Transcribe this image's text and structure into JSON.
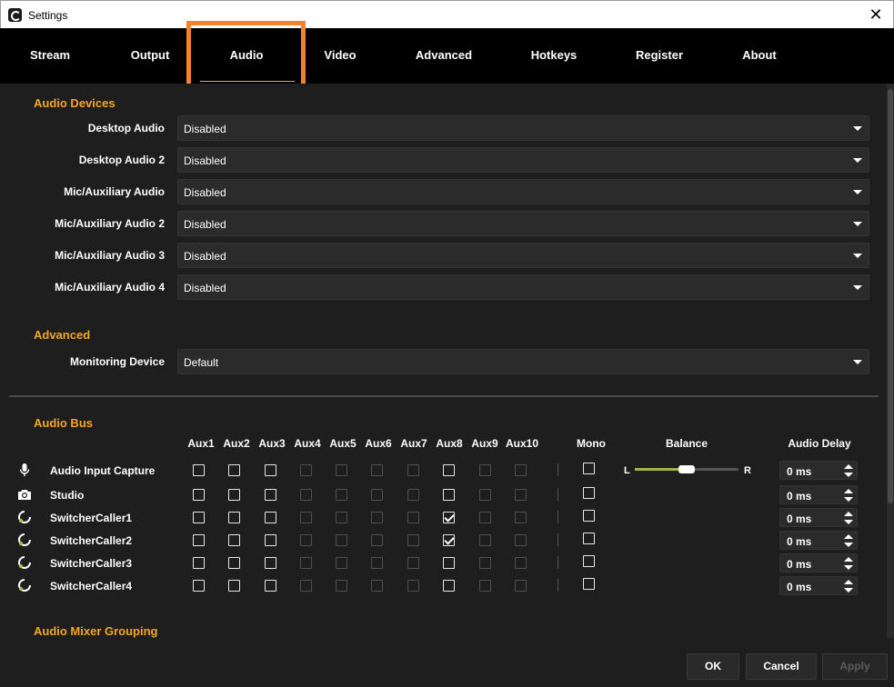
{
  "window": {
    "title": "Settings"
  },
  "tabs": [
    {
      "label": "Stream",
      "active": false
    },
    {
      "label": "Output",
      "active": false
    },
    {
      "label": "Audio",
      "active": true
    },
    {
      "label": "Video",
      "active": false
    },
    {
      "label": "Advanced",
      "active": false
    },
    {
      "label": "Hotkeys",
      "active": false
    },
    {
      "label": "Register",
      "active": false
    },
    {
      "label": "About",
      "active": false
    }
  ],
  "audio_devices": {
    "title": "Audio Devices",
    "rows": [
      {
        "label": "Desktop Audio",
        "value": "Disabled"
      },
      {
        "label": "Desktop Audio 2",
        "value": "Disabled"
      },
      {
        "label": "Mic/Auxiliary Audio",
        "value": "Disabled"
      },
      {
        "label": "Mic/Auxiliary Audio 2",
        "value": "Disabled"
      },
      {
        "label": "Mic/Auxiliary Audio 3",
        "value": "Disabled"
      },
      {
        "label": "Mic/Auxiliary Audio 4",
        "value": "Disabled"
      }
    ]
  },
  "advanced": {
    "title": "Advanced",
    "monitoring_label": "Monitoring Device",
    "monitoring_value": "Default"
  },
  "audio_bus": {
    "title": "Audio Bus",
    "aux_columns": [
      "Aux1",
      "Aux2",
      "Aux3",
      "Aux4",
      "Aux5",
      "Aux6",
      "Aux7",
      "Aux8",
      "Aux9",
      "Aux10"
    ],
    "aux_enabled": [
      true,
      true,
      true,
      false,
      false,
      false,
      false,
      true,
      false,
      false
    ],
    "mono_label": "Mono",
    "balance_label": "Balance",
    "balance_left": "L",
    "balance_right": "R",
    "balance_value": 0.5,
    "delay_label": "Audio Delay",
    "sources": [
      {
        "name": "Audio Input Capture",
        "icon": "microphone-icon",
        "checked": [
          false,
          false,
          false,
          false,
          false,
          false,
          false,
          false,
          false,
          false
        ],
        "mono": false,
        "has_balance": true,
        "delay": "0 ms"
      },
      {
        "name": "Studio",
        "icon": "camera-icon",
        "checked": [
          false,
          false,
          false,
          false,
          false,
          false,
          false,
          false,
          false,
          false
        ],
        "mono": false,
        "has_balance": false,
        "delay": "0 ms"
      },
      {
        "name": "SwitcherCaller1",
        "icon": "switcher-caller-icon",
        "checked": [
          false,
          false,
          false,
          false,
          false,
          false,
          false,
          true,
          false,
          false
        ],
        "mono": false,
        "has_balance": false,
        "delay": "0 ms"
      },
      {
        "name": "SwitcherCaller2",
        "icon": "switcher-caller-icon",
        "checked": [
          false,
          false,
          false,
          false,
          false,
          false,
          false,
          true,
          false,
          false
        ],
        "mono": false,
        "has_balance": false,
        "delay": "0 ms"
      },
      {
        "name": "SwitcherCaller3",
        "icon": "switcher-caller-icon",
        "checked": [
          false,
          false,
          false,
          false,
          false,
          false,
          false,
          false,
          false,
          false
        ],
        "mono": false,
        "has_balance": false,
        "delay": "0 ms"
      },
      {
        "name": "SwitcherCaller4",
        "icon": "switcher-caller-icon",
        "checked": [
          false,
          false,
          false,
          false,
          false,
          false,
          false,
          false,
          false,
          false
        ],
        "mono": false,
        "has_balance": false,
        "delay": "0 ms"
      }
    ]
  },
  "grouping": {
    "title": "Audio Mixer Grouping"
  },
  "footer": {
    "ok": "OK",
    "cancel": "Cancel",
    "apply": "Apply"
  },
  "colors": {
    "accent": "#f5a623",
    "highlight": "#f2822e",
    "slider": "#a7b44a",
    "background": "#1e1e1e"
  }
}
